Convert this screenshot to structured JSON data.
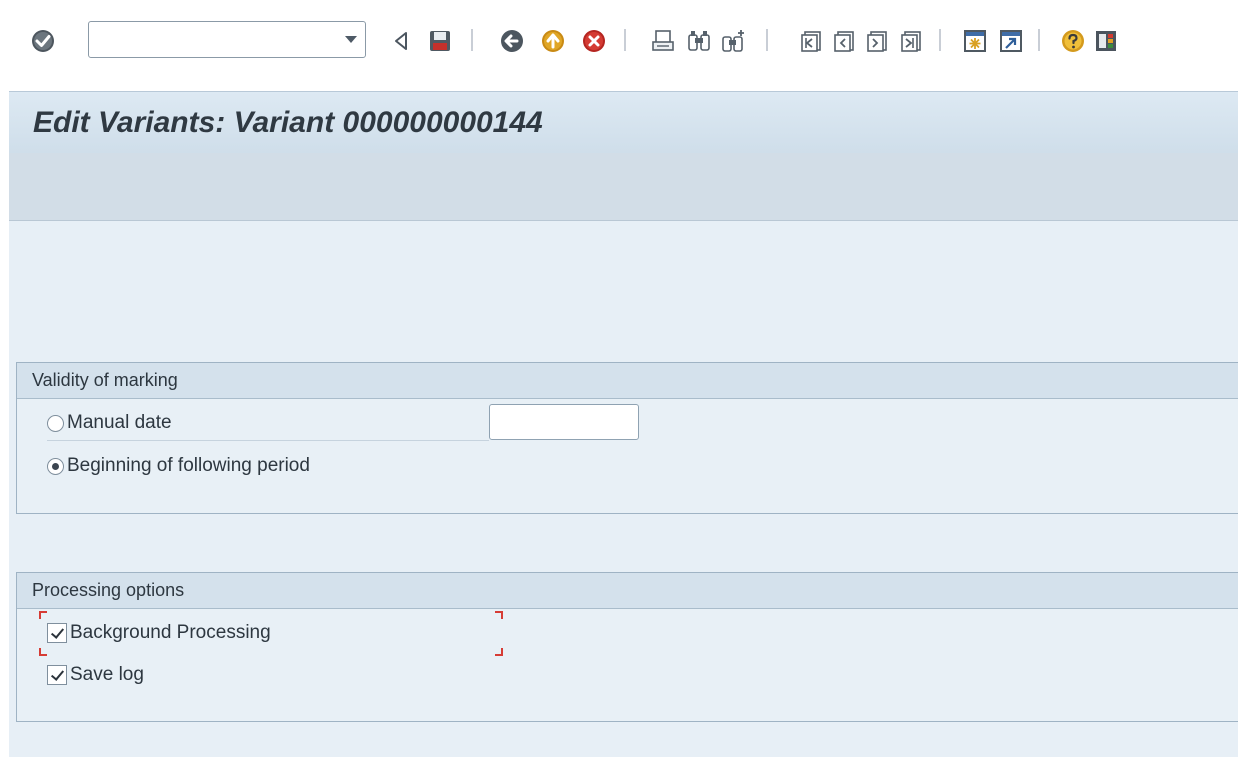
{
  "toolbar": {
    "command_field": {
      "value": "",
      "placeholder": ""
    },
    "icons": [
      "enter-icon",
      "back-arrow-icon",
      "save-icon",
      "back-icon",
      "exit-icon",
      "cancel-icon",
      "print-icon",
      "find-icon",
      "find-next-icon",
      "first-page-icon",
      "previous-page-icon",
      "next-page-icon",
      "last-page-icon",
      "create-session-icon",
      "create-shortcut-icon",
      "help-icon",
      "layout-menu-icon"
    ]
  },
  "page": {
    "title": "Edit Variants: Variant 000000000144"
  },
  "validity": {
    "heading": "Validity of marking",
    "manual_date_label": "Manual date",
    "manual_date_value": "",
    "manual_date_selected": false,
    "following_period_label": "Beginning of following period",
    "following_period_selected": true
  },
  "processing": {
    "heading": "Processing options",
    "background_label": "Background Processing",
    "background_checked": true,
    "save_log_label": "Save log",
    "save_log_checked": true
  },
  "colors": {
    "title_bg": "#dde9f3",
    "frame_bg": "#e8f0f6",
    "focus_marker": "#d63c35"
  }
}
